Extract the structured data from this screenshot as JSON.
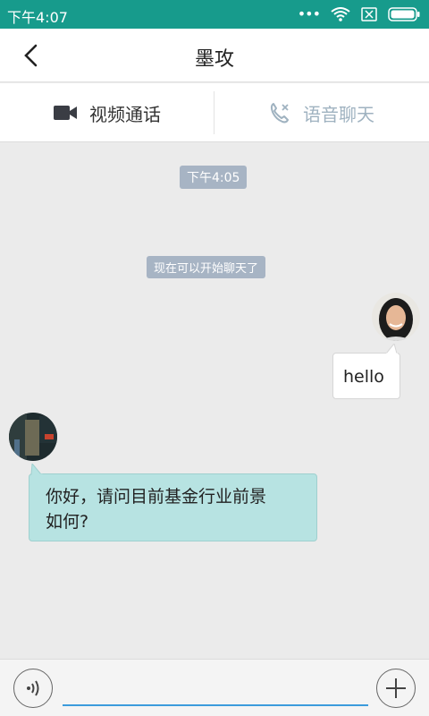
{
  "status_bar": {
    "time": "下午4:07",
    "dots": "•••"
  },
  "header": {
    "title": "墨攻"
  },
  "call_bar": {
    "video_label": "视频通话",
    "voice_label": "语音聊天"
  },
  "messages": {
    "timestamp": "下午4:05",
    "system_notice": "现在可以开始聊天了",
    "outgoing": {
      "text": "hello"
    },
    "incoming": {
      "line1": "你好，请问目前基金行业前景",
      "line2": "如何?"
    }
  },
  "input_bar": {
    "placeholder": ""
  },
  "colors": {
    "status_bar": "#179b8c",
    "incoming_bubble": "#b7e3e2",
    "input_underline": "#3b9bdc"
  }
}
